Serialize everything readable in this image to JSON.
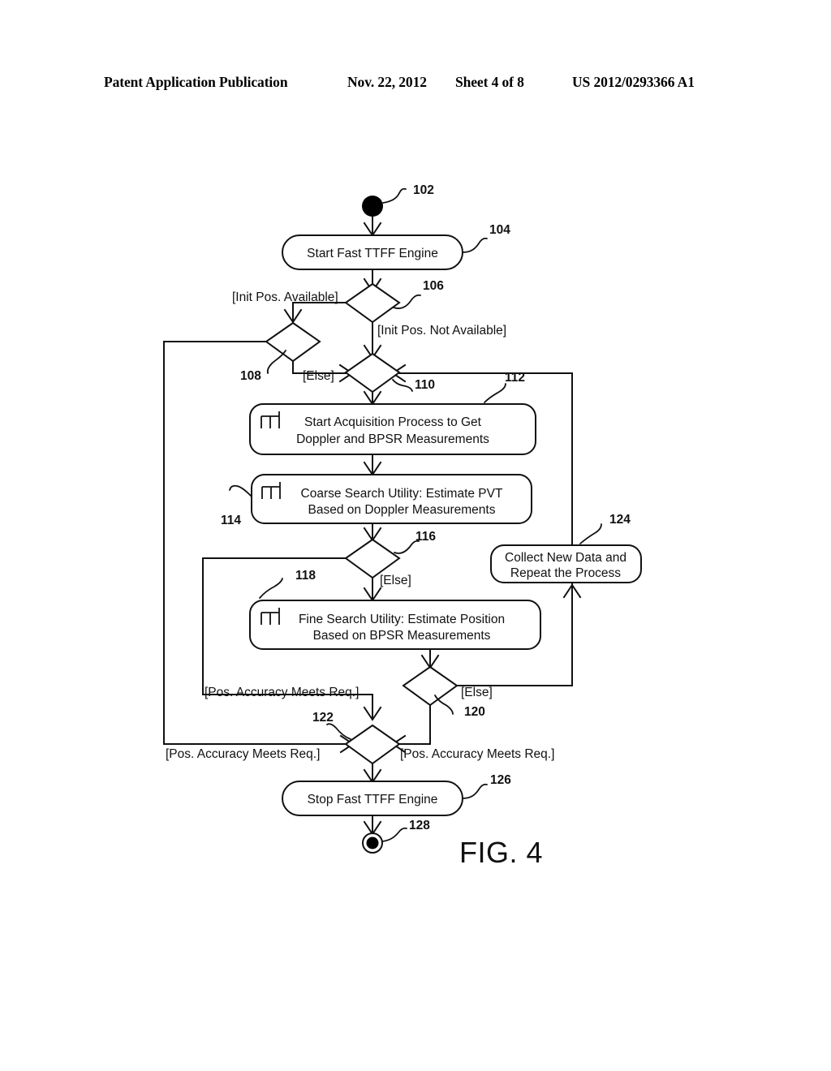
{
  "header": {
    "publication": "Patent Application Publication",
    "date": "Nov. 22, 2012",
    "sheet": "Sheet 4 of 8",
    "number": "US 2012/0293366 A1"
  },
  "figure": {
    "caption": "FIG. 4"
  },
  "nodes": {
    "start_node": {
      "ref": "102",
      "label": ""
    },
    "start_engine": {
      "ref": "104",
      "label": "Start Fast TTFF Engine"
    },
    "decision_init": {
      "ref": "106",
      "label": ""
    },
    "decision_108": {
      "ref": "108",
      "label": ""
    },
    "merge_110": {
      "ref": "110",
      "label": ""
    },
    "acquisition": {
      "ref": "112",
      "line1": "Start Acquisition Process to Get",
      "line2": "Doppler and BPSR Measurements"
    },
    "coarse_search": {
      "ref": "114",
      "line1": "Coarse Search Utility: Estimate PVT",
      "line2": "Based on Doppler Measurements"
    },
    "decision_116": {
      "ref": "116",
      "label": ""
    },
    "fine_search": {
      "ref": "118",
      "line1": "Fine Search Utility: Estimate Position",
      "line2": "Based on BPSR Measurements"
    },
    "decision_120": {
      "ref": "120",
      "label": ""
    },
    "merge_122": {
      "ref": "122",
      "label": ""
    },
    "collect_new_data": {
      "ref": "124",
      "line1": "Collect New Data and",
      "line2": "Repeat the Process"
    },
    "stop_engine": {
      "ref": "126",
      "label": "Stop Fast TTFF Engine"
    },
    "end_node": {
      "ref": "128",
      "label": ""
    }
  },
  "guards": {
    "init_pos_available": "[Init Pos. Available]",
    "init_pos_not_available": "[Init Pos. Not Available]",
    "else_108": "[Else]",
    "else_116": "[Else]",
    "else_120": "[Else]",
    "accuracy_meets_inner": "[Pos. Accuracy Meets Req.]",
    "accuracy_meets_outer": "[Pos. Accuracy Meets Req.]",
    "accuracy_meets_right": "[Pos. Accuracy Meets Req.]"
  },
  "colors": {
    "ink": "#111111",
    "paper": "#ffffff"
  }
}
